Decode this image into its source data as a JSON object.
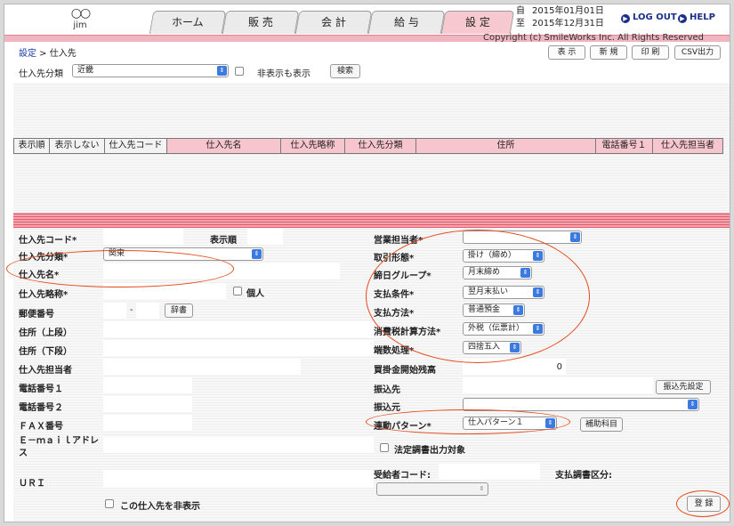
{
  "header": {
    "logo_mark": "○○",
    "user": "jim",
    "tabs": [
      "ホーム",
      "販 売",
      "会 計",
      "給 与",
      "設 定"
    ],
    "active_tab": "設 定",
    "date_from_label": "自",
    "date_from": "2015年01月01日",
    "date_to_label": "至",
    "date_to": "2015年12月31日",
    "logout": "LOG OUT",
    "help": "HELP",
    "copyright": "Copyright (c) SmileWorks Inc. All Rights Reserved"
  },
  "breadcrumb": {
    "link": "設定",
    "sep": " > ",
    "current": "仕入先"
  },
  "toolbar": {
    "show": "表 示",
    "new": "新 規",
    "print": "印 刷",
    "csv": "CSV出力"
  },
  "filter": {
    "label": "仕入先分類",
    "value": "近畿",
    "show_hidden_label": "非表示も表示",
    "search": "検索"
  },
  "table": {
    "columns": [
      "表示順",
      "表示しない",
      "仕入先コード",
      "仕入先名",
      "仕入先略称",
      "仕入先分類",
      "住所",
      "電話番号１",
      "仕入先担当者"
    ],
    "rows": []
  },
  "form": {
    "code_label": "仕入先コード*",
    "order_label": "表示順",
    "category_label": "仕入先分類*",
    "category_value": "関東",
    "name_label": "仕入先名*",
    "short_label": "仕入先略称*",
    "individual_label": "個人",
    "zip_label": "郵便番号",
    "zip_sep": "-",
    "dict_button": "辞書",
    "addr1_label": "住所（上段）",
    "addr2_label": "住所（下段）",
    "contact_label": "仕入先担当者",
    "tel1_label": "電話番号１",
    "tel2_label": "電話番号２",
    "fax_label": "ＦＡＸ番号",
    "email_label": "Ｅ－ｍａｉｌアドレス",
    "url_label": "ＵＲＩ",
    "hide_label": "この仕入先を非表示",
    "sales_rep_label": "営業担当者*",
    "sales_rep_value": "",
    "trade_label": "取引形態*",
    "trade_value": "掛け（締め）",
    "closing_label": "締日グループ*",
    "closing_value": "月末締め",
    "payment_label": "支払条件*",
    "payment_value": "翌月末払い",
    "method_label": "支払方法*",
    "method_value": "普通預金",
    "tax_label": "消費税計算方法*",
    "tax_value": "外税（伝票計）",
    "rounding_label": "端数処理*",
    "rounding_value": "四捨五入",
    "opening_label": "買掛金開始残高",
    "opening_value": "0",
    "transfer_to_label": "振込先",
    "transfer_button": "振込先設定",
    "transfer_from_label": "振込元",
    "transfer_from_value": "",
    "link_pattern_label": "連動パターン*",
    "link_pattern_value": "仕入パターン１",
    "aux_button": "補助科目",
    "statutory_label": "法定調書出力対象",
    "recipient_label": "受給者コード:",
    "doc_category_label": "支払調書区分:",
    "register_button": "登 録"
  },
  "colors": {
    "accent": "#e44a1a",
    "tab_active": "#f6c9d0",
    "header_bar": "#f0b5c0",
    "select_arrow": "#3b7ae0"
  }
}
